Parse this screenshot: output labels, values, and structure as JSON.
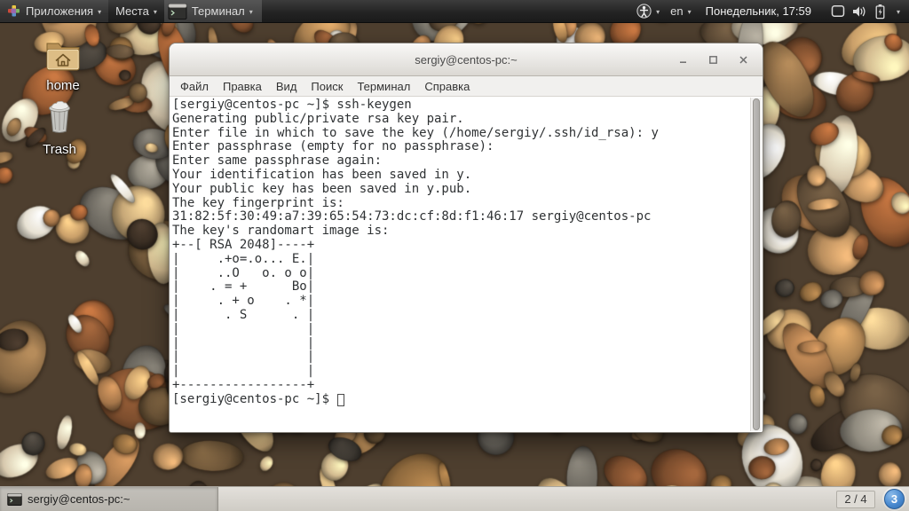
{
  "top_panel": {
    "applications_label": "Приложения",
    "places_label": "Места",
    "active_app_label": "Терминал",
    "keyboard_layout": "en",
    "clock": "Понедельник, 17:59"
  },
  "desktop_icons": [
    {
      "label": "home"
    },
    {
      "label": "Trash"
    }
  ],
  "terminal_window": {
    "title": "sergiy@centos-pc:~",
    "menu_items": [
      "Файл",
      "Правка",
      "Вид",
      "Поиск",
      "Терминал",
      "Справка"
    ],
    "output_lines": [
      "[sergiy@centos-pc ~]$ ssh-keygen",
      "Generating public/private rsa key pair.",
      "Enter file in which to save the key (/home/sergiy/.ssh/id_rsa): y",
      "Enter passphrase (empty for no passphrase):",
      "Enter same passphrase again:",
      "Your identification has been saved in y.",
      "Your public key has been saved in y.pub.",
      "The key fingerprint is:",
      "31:82:5f:30:49:a7:39:65:54:73:dc:cf:8d:f1:46:17 sergiy@centos-pc",
      "The key's randomart image is:",
      "+--[ RSA 2048]----+",
      "|     .+o=.o... E.|",
      "|     ..O   o. o o|",
      "|    . = +      Bo|",
      "|     . + o    . *|",
      "|      . S      . |",
      "|                 |",
      "|                 |",
      "|                 |",
      "|                 |",
      "+-----------------+"
    ],
    "prompt": "[sergiy@centos-pc ~]$ "
  },
  "taskbar": {
    "task_button_label": "sergiy@centos-pc:~",
    "workspace_pager": "2 / 4",
    "notification_badge": "3"
  },
  "icons": {
    "caret": "▾",
    "names": [
      "applications-menu-icon",
      "terminal-app-icon",
      "accessibility-icon",
      "display-icon",
      "volume-icon",
      "battery-charging-icon",
      "home-folder-icon",
      "trash-icon",
      "minimize-icon",
      "maximize-icon",
      "close-icon"
    ]
  },
  "colors": {
    "panel_bg": "#2a2a2a",
    "titlebar_bg": "#e8e6e2",
    "terminal_bg": "#ffffff",
    "terminal_text": "#2f3234",
    "notification_blue": "#4a8ad0"
  }
}
